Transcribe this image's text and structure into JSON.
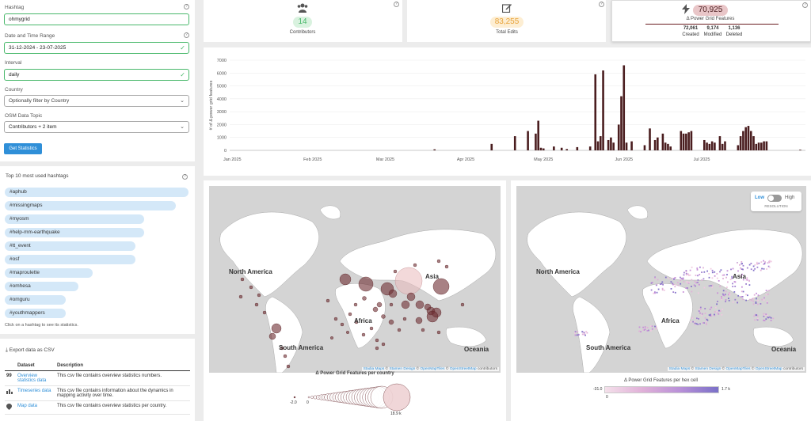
{
  "filters": {
    "hashtag_label": "Hashtag",
    "hashtag_value": "ohmygrid",
    "date_label": "Date and Time Range",
    "date_value": "31-12-2024 - 23-07-2025",
    "interval_label": "Interval",
    "interval_value": "daily",
    "country_label": "Country",
    "country_placeholder": "Optionally filter by Country",
    "topic_label": "OSM Data Topic",
    "topic_value": "Contributors + 2 item",
    "submit_label": "Get Statistics"
  },
  "hashtags": {
    "title": "Top 10 most used hashtags",
    "items": [
      {
        "label": "#aphub",
        "share": 1.0
      },
      {
        "label": "#missingmaps",
        "share": 0.93
      },
      {
        "label": "#myosm",
        "share": 0.76
      },
      {
        "label": "#help-mm-earthquake",
        "share": 0.76
      },
      {
        "label": "#tt_event",
        "share": 0.71
      },
      {
        "label": "#osf",
        "share": 0.71
      },
      {
        "label": "#maproulette",
        "share": 0.48
      },
      {
        "label": "#omhesa",
        "share": 0.4
      },
      {
        "label": "#omguru",
        "share": 0.33
      },
      {
        "label": "#youthmappers",
        "share": 0.33
      }
    ],
    "hint": "Click on a hashtag to see its statistics."
  },
  "export": {
    "title": "Export data as CSV",
    "col_dataset": "Dataset",
    "col_description": "Description",
    "rows": [
      {
        "icon": "99",
        "name": "Overview statistics data",
        "description": "This csv file contains overview statistics numbers."
      },
      {
        "icon": "bar-chart-icon",
        "name": "Timeseries data",
        "description": "This csv file contains information about the dynamics in mapping activity over time."
      },
      {
        "icon": "map-pin-icon",
        "name": "Map data",
        "description": "This csv file contains overview statistics per country."
      }
    ]
  },
  "kpis": {
    "contributors": {
      "value": "14",
      "label": "Contributors",
      "icon": "users-icon",
      "color": "#49b86b",
      "bg": "#d9f2df"
    },
    "edits": {
      "value": "83,255",
      "label": "Total Edits",
      "icon": "edit-icon",
      "color": "#e8a33a",
      "bg": "#fdeed3"
    },
    "features": {
      "value": "70,925",
      "label": "Δ Power Grid Features",
      "icon": "bolt-icon",
      "color": "#4a1d1f",
      "bg": "#e9c6c8",
      "created_value": "72,061",
      "created_label": "Created",
      "modified_value": "9,174",
      "modified_label": "Modified",
      "deleted_value": "1,136",
      "deleted_label": "Deleted"
    }
  },
  "chart_data": {
    "type": "bar",
    "ylabel": "# of Δ power grid features",
    "ylim": [
      0,
      7000
    ],
    "yticks": [
      0,
      1000,
      2000,
      3000,
      4000,
      5000,
      6000,
      7000
    ],
    "xticks": [
      "Jan 2025",
      "Feb 2025",
      "Mar 2025",
      "Apr 2025",
      "May 2025",
      "Jun 2025",
      "Jul 2025"
    ],
    "color": "#4a1d1f",
    "x_start": "2024-12-31",
    "points": [
      [
        "2025-03-20",
        80
      ],
      [
        "2025-04-11",
        500
      ],
      [
        "2025-04-20",
        1100
      ],
      [
        "2025-04-25",
        1500
      ],
      [
        "2025-04-28",
        1300
      ],
      [
        "2025-04-29",
        2300
      ],
      [
        "2025-04-30",
        200
      ],
      [
        "2025-05-01",
        150
      ],
      [
        "2025-05-05",
        300
      ],
      [
        "2025-05-08",
        200
      ],
      [
        "2025-05-10",
        100
      ],
      [
        "2025-05-14",
        250
      ],
      [
        "2025-05-19",
        300
      ],
      [
        "2025-05-21",
        5900
      ],
      [
        "2025-05-22",
        700
      ],
      [
        "2025-05-23",
        1100
      ],
      [
        "2025-05-24",
        6200
      ],
      [
        "2025-05-26",
        800
      ],
      [
        "2025-05-27",
        1000
      ],
      [
        "2025-05-28",
        600
      ],
      [
        "2025-05-30",
        2000
      ],
      [
        "2025-05-31",
        4200
      ],
      [
        "2025-06-01",
        6600
      ],
      [
        "2025-06-02",
        600
      ],
      [
        "2025-06-04",
        700
      ],
      [
        "2025-06-09",
        400
      ],
      [
        "2025-06-11",
        1700
      ],
      [
        "2025-06-13",
        800
      ],
      [
        "2025-06-14",
        1000
      ],
      [
        "2025-06-16",
        1300
      ],
      [
        "2025-06-17",
        600
      ],
      [
        "2025-06-18",
        500
      ],
      [
        "2025-06-19",
        300
      ],
      [
        "2025-06-23",
        1500
      ],
      [
        "2025-06-24",
        1300
      ],
      [
        "2025-06-25",
        1300
      ],
      [
        "2025-06-26",
        1400
      ],
      [
        "2025-06-27",
        1500
      ],
      [
        "2025-07-02",
        800
      ],
      [
        "2025-07-03",
        600
      ],
      [
        "2025-07-04",
        500
      ],
      [
        "2025-07-05",
        700
      ],
      [
        "2025-07-06",
        600
      ],
      [
        "2025-07-08",
        1100
      ],
      [
        "2025-07-09",
        500
      ],
      [
        "2025-07-10",
        700
      ],
      [
        "2025-07-15",
        400
      ],
      [
        "2025-07-16",
        1100
      ],
      [
        "2025-07-17",
        1500
      ],
      [
        "2025-07-18",
        1800
      ],
      [
        "2025-07-19",
        1900
      ],
      [
        "2025-07-20",
        1500
      ],
      [
        "2025-07-21",
        1100
      ],
      [
        "2025-07-22",
        500
      ],
      [
        "2025-07-23",
        600
      ],
      [
        "2025-07-24",
        600
      ],
      [
        "2025-07-25",
        700
      ],
      [
        "2025-07-26",
        700
      ],
      [
        "2025-08-08",
        50
      ]
    ]
  },
  "map_left": {
    "labels": [
      "North America",
      "South America",
      "Africa",
      "Asia",
      "Oceania"
    ],
    "attribution": [
      "Stadia Maps",
      "Stamen Design",
      "OpenMapTiles",
      "OpenStreetMap",
      "contributors"
    ],
    "legend_title": "Δ Power Grid Features per country",
    "legend_min": "-2.0",
    "legend_zero": "0",
    "legend_max": "18.9 k"
  },
  "map_right": {
    "labels": [
      "North America",
      "South America",
      "Africa",
      "Asia",
      "Oceania"
    ],
    "attribution": [
      "Stadia Maps",
      "Stamen Design",
      "OpenMapTiles",
      "OpenStreetMap",
      "contributors"
    ],
    "toggle_low": "Low",
    "toggle_high": "High",
    "toggle_caption": "RESOLUTION",
    "legend_title": "Δ Power Grid Features per hex cell",
    "legend_min": "-31.0",
    "legend_zero": "0",
    "legend_max": "1.7 k"
  }
}
